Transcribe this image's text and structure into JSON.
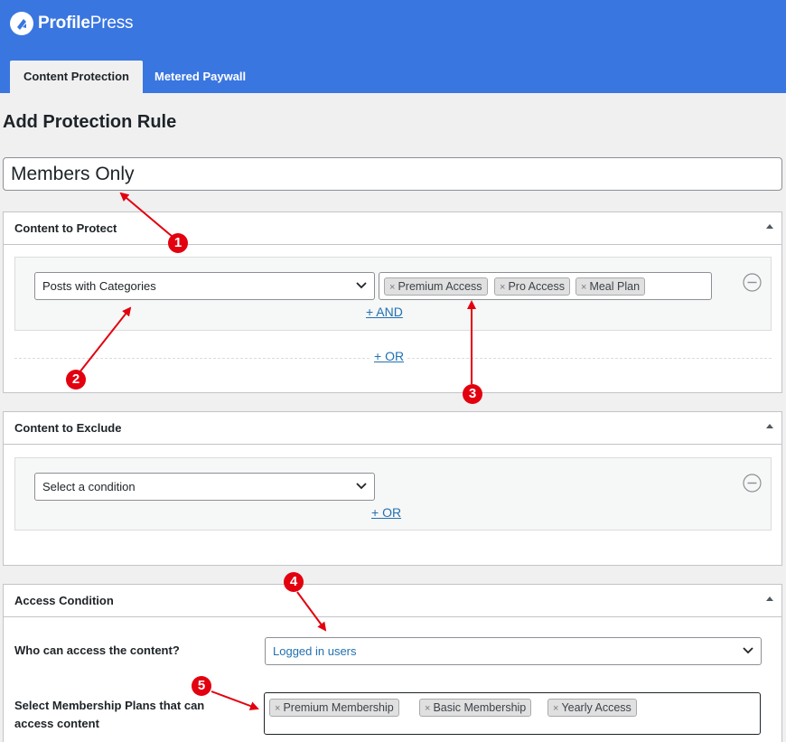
{
  "app": {
    "brand_bold": "Profile",
    "brand_light": "Press"
  },
  "tabs": [
    {
      "label": "Content Protection",
      "active": true
    },
    {
      "label": "Metered Paywall",
      "active": false
    }
  ],
  "page_title": "Add Protection Rule",
  "rule_title": {
    "value": "Members Only"
  },
  "content_to_protect": {
    "title": "Content to Protect",
    "condition": "Posts with Categories",
    "tags": [
      "Premium Access",
      "Pro Access",
      "Meal Plan"
    ],
    "and_link": "+ AND",
    "or_link": "+ OR"
  },
  "content_to_exclude": {
    "title": "Content to Exclude",
    "condition_placeholder": "Select a condition",
    "or_link": "+ OR"
  },
  "access_condition": {
    "title": "Access Condition",
    "who_label": "Who can access the content?",
    "who_value": "Logged in users",
    "plans_label_line1": "Select Membership Plans that can",
    "plans_label_line2": "access content",
    "plans": [
      "Premium Membership",
      "Basic Membership",
      "Yearly Access"
    ]
  },
  "callouts": [
    "1",
    "2",
    "3",
    "4",
    "5"
  ],
  "colors": {
    "header": "#3a76e0",
    "link": "#2271b1",
    "callout": "#e3000f",
    "selected_value": "#2271b1"
  }
}
